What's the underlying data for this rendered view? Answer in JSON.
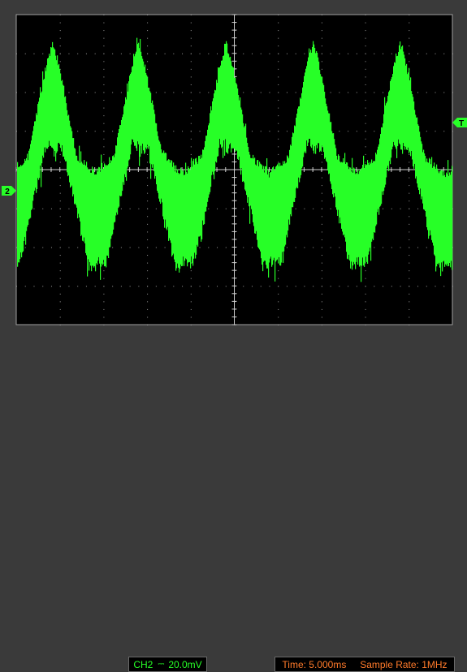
{
  "screen": {
    "background": "#3a3a3a",
    "graticule_color": "#000000",
    "trace_color": "#27ff27",
    "marker_color": "#27ff27"
  },
  "markers": {
    "channel_marker": "2",
    "trigger_marker": "T"
  },
  "status": {
    "channel_label": "CH2",
    "coupling_icon": "dc-coupling-icon",
    "volts_per_div": "20.0mV",
    "time_label": "Time: 5.000ms",
    "sample_rate_label": "Sample Rate: 1MHz"
  }
}
